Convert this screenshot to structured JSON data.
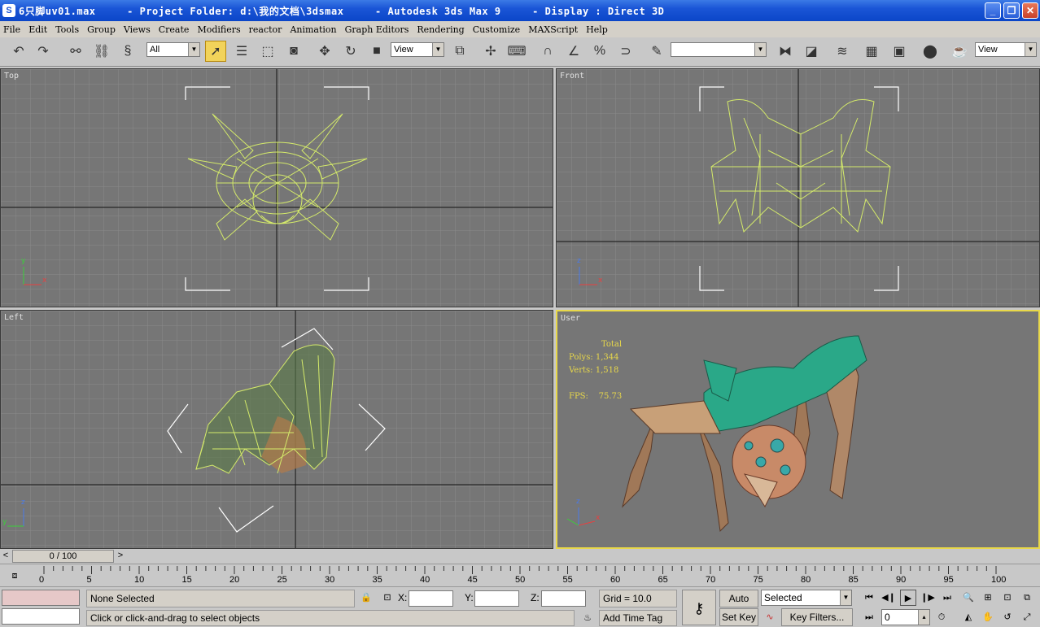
{
  "titlebar": {
    "title": "6只脚uv01.max     - Project Folder: d:\\我的文档\\3dsmax     - Autodesk 3ds Max 9     - Display : Direct 3D",
    "minimize": "_",
    "maximize": "❐",
    "close": "✕"
  },
  "menu": [
    "File",
    "Edit",
    "Tools",
    "Group",
    "Views",
    "Create",
    "Modifiers",
    "reactor",
    "Animation",
    "Graph Editors",
    "Rendering",
    "Customize",
    "MAXScript",
    "Help"
  ],
  "toolbar": {
    "filter_value": "All",
    "refcoord_value": "View",
    "named_selection_value": "",
    "render_view_value": "View"
  },
  "viewports": {
    "top": {
      "label": "Top"
    },
    "front": {
      "label": "Front"
    },
    "left": {
      "label": "Left"
    },
    "user": {
      "label": "User",
      "stats_total": "Total",
      "stats_polys": "Polys: 1,344",
      "stats_verts": "Verts: 1,518",
      "stats_fps": "FPS:    75.73"
    }
  },
  "axis_labels": {
    "x": "x",
    "y": "y",
    "z": "z"
  },
  "timeline": {
    "slider_text": "0 / 100",
    "ticks": [
      "0",
      "5",
      "10",
      "15",
      "20",
      "25",
      "30",
      "35",
      "40",
      "45",
      "50",
      "55",
      "60",
      "65",
      "70",
      "75",
      "80",
      "85",
      "90",
      "95",
      "100"
    ]
  },
  "status": {
    "selection": "None Selected",
    "prompt": "Click or click-and-drag to select objects",
    "x_label": "X:",
    "y_label": "Y:",
    "z_label": "Z:",
    "grid": "Grid = 10.0",
    "add_time_tag": "Add Time Tag",
    "auto_key": "Auto Key",
    "set_key": "Set Key",
    "key_mode_value": "Selected",
    "key_filters": "Key Filters...",
    "frame_value": "0"
  },
  "colors": {
    "wire": "#d4ea6a",
    "viewport_bg": "#767676",
    "active_border": "#e8d84a",
    "stats_text": "#e8d84a"
  }
}
